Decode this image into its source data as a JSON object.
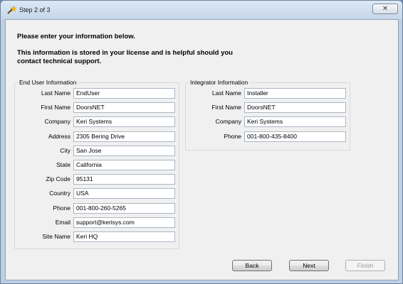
{
  "window": {
    "title": "Step 2 of 3",
    "close_symbol": "✕",
    "accent_color": "#c6d7ea"
  },
  "intro": {
    "line1": "Please enter your information below.",
    "line2": "This information is stored in your license and is helpful should you contact technical support."
  },
  "end_user": {
    "title": "End User Information",
    "fields": [
      {
        "label": "Last Name",
        "value": "EndUser"
      },
      {
        "label": "First Name",
        "value": "DoorsNET"
      },
      {
        "label": "Company",
        "value": "Keri Systems"
      },
      {
        "label": "Address",
        "value": "2305 Bering Drive"
      },
      {
        "label": "City",
        "value": "San Jose"
      },
      {
        "label": "State",
        "value": "California"
      },
      {
        "label": "Zip Code",
        "value": "95131"
      },
      {
        "label": "Country",
        "value": "USA"
      },
      {
        "label": "Phone",
        "value": "001-800-260-5265"
      },
      {
        "label": "Email",
        "value": "support@kerisys.com"
      },
      {
        "label": "Site Name",
        "value": "Keri HQ"
      }
    ]
  },
  "integrator": {
    "title": "Integrator Information",
    "fields": [
      {
        "label": "Last Name",
        "value": "Installer"
      },
      {
        "label": "First Name",
        "value": "DoorsNET"
      },
      {
        "label": "Company",
        "value": "Keri Systems"
      },
      {
        "label": "Phone",
        "value": "001-800-435-8400"
      }
    ]
  },
  "buttons": {
    "back": "Back",
    "next": "Next",
    "finish": "Finish"
  }
}
